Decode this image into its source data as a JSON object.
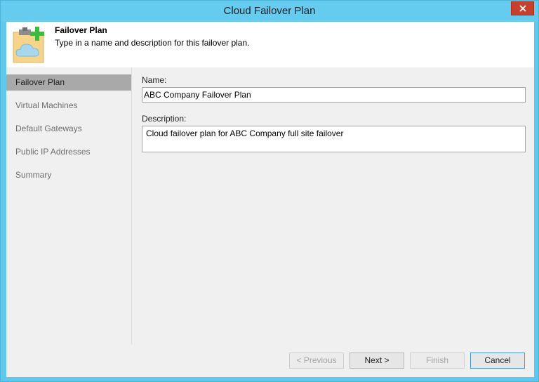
{
  "window": {
    "title": "Cloud Failover Plan"
  },
  "header": {
    "title": "Failover Plan",
    "subtitle": "Type in a name and description for this failover plan.",
    "icon": "cloud-plan-add-icon"
  },
  "sidebar": {
    "items": [
      {
        "label": "Failover Plan",
        "active": true
      },
      {
        "label": "Virtual Machines",
        "active": false
      },
      {
        "label": "Default Gateways",
        "active": false
      },
      {
        "label": "Public IP Addresses",
        "active": false
      },
      {
        "label": "Summary",
        "active": false
      }
    ]
  },
  "form": {
    "name_label": "Name:",
    "name_value": "ABC Company Failover Plan",
    "description_label": "Description:",
    "description_value": "Cloud failover plan for ABC Company full site failover"
  },
  "footer": {
    "previous_label": "< Previous",
    "next_label": "Next >",
    "finish_label": "Finish",
    "cancel_label": "Cancel"
  },
  "colors": {
    "titlebar": "#65cbef",
    "close_button": "#c7402c",
    "active_nav": "#a9a9a9",
    "plus_green": "#3dbb3f"
  }
}
